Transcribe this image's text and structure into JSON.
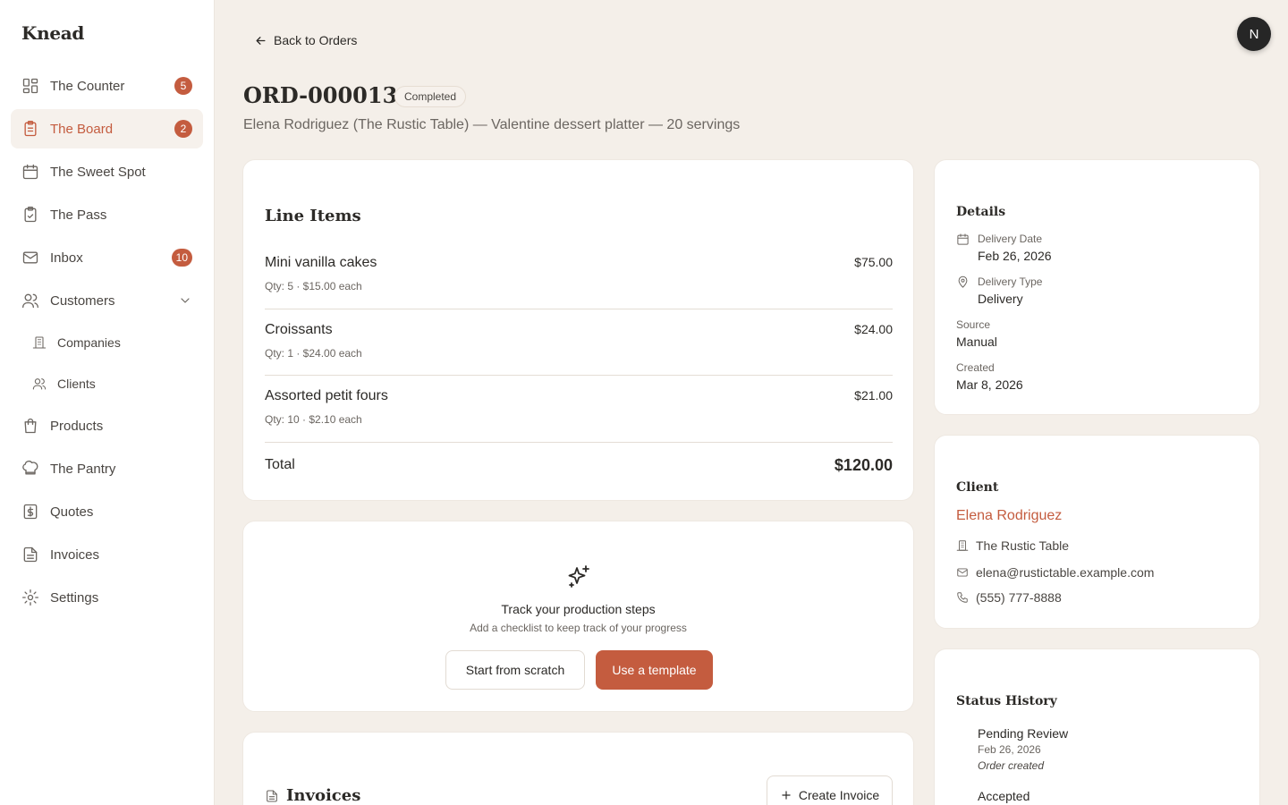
{
  "app": {
    "brand": "Knead",
    "avatar_initial": "N"
  },
  "sidebar": {
    "items": [
      {
        "label": "The Counter",
        "icon": "dashboard-icon",
        "badge": "5"
      },
      {
        "label": "The Board",
        "icon": "clipboard-icon",
        "badge": "2",
        "active": true
      },
      {
        "label": "The Sweet Spot",
        "icon": "calendar-icon"
      },
      {
        "label": "The Pass",
        "icon": "clipboard-check-icon"
      },
      {
        "label": "Inbox",
        "icon": "mail-icon",
        "badge": "10"
      },
      {
        "label": "Customers",
        "icon": "users-icon",
        "expanded": true
      },
      {
        "label": "Products",
        "icon": "shopping-bag-icon"
      },
      {
        "label": "The Pantry",
        "icon": "chef-hat-icon"
      },
      {
        "label": "Quotes",
        "icon": "dollar-receipt-icon"
      },
      {
        "label": "Invoices",
        "icon": "file-text-icon"
      },
      {
        "label": "Settings",
        "icon": "gear-icon"
      }
    ],
    "customers_sub": [
      {
        "label": "Companies",
        "icon": "building-icon"
      },
      {
        "label": "Clients",
        "icon": "users-icon"
      }
    ]
  },
  "header": {
    "back_label": "Back to Orders",
    "order_id": "ORD-000013",
    "status": "Completed",
    "subtitle": "Elena Rodriguez (The Rustic Table) — Valentine dessert platter — 20 servings"
  },
  "line_items": {
    "title": "Line Items",
    "items": [
      {
        "name": "Mini vanilla cakes",
        "meta": "Qty: 5 · $15.00 each",
        "price": "$75.00"
      },
      {
        "name": "Croissants",
        "meta": "Qty: 1 · $24.00 each",
        "price": "$24.00"
      },
      {
        "name": "Assorted petit fours",
        "meta": "Qty: 10 · $2.10 each",
        "price": "$21.00"
      }
    ],
    "total_label": "Total",
    "total_value": "$120.00"
  },
  "production": {
    "title": "Track your production steps",
    "subtitle": "Add a checklist to keep track of your progress",
    "btn_scratch": "Start from scratch",
    "btn_template": "Use a template"
  },
  "invoices": {
    "title": "Invoices",
    "btn_create": "Create Invoice"
  },
  "details": {
    "title": "Details",
    "delivery_date_label": "Delivery Date",
    "delivery_date": "Feb 26, 2026",
    "delivery_type_label": "Delivery Type",
    "delivery_type": "Delivery",
    "source_label": "Source",
    "source": "Manual",
    "created_label": "Created",
    "created": "Mar 8, 2026"
  },
  "client": {
    "title": "Client",
    "name": "Elena Rodriguez",
    "company": "The Rustic Table",
    "email": "elena@rustictable.example.com",
    "phone": "(555) 777-8888"
  },
  "status_history": {
    "title": "Status History",
    "entries": [
      {
        "status": "Pending Review",
        "date": "Feb 26, 2026",
        "note": "Order created"
      },
      {
        "status": "Accepted"
      }
    ]
  },
  "colors": {
    "accent": "#c45c3f",
    "background": "#f4efe9",
    "card": "#ffffff"
  }
}
